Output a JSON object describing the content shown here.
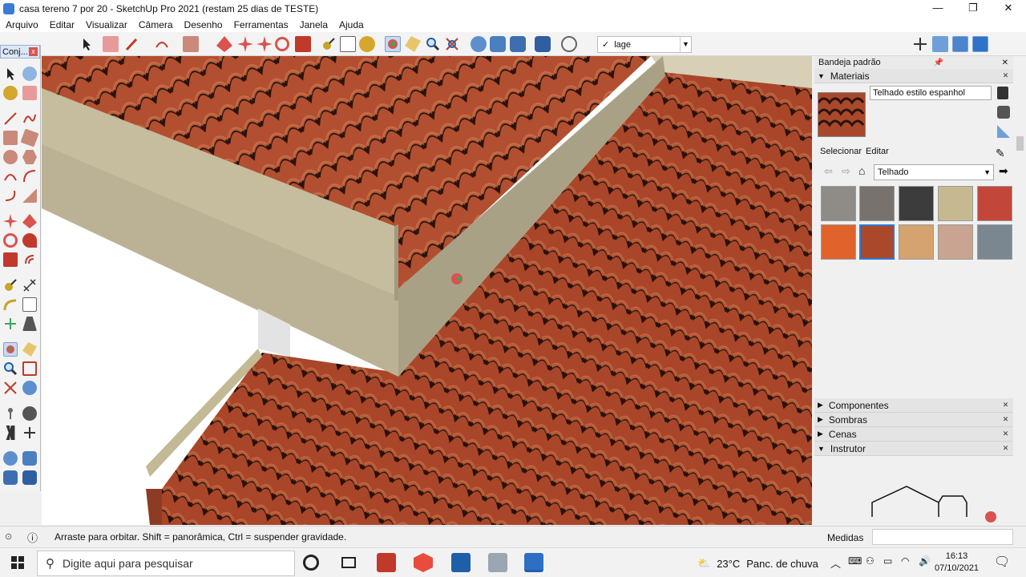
{
  "window": {
    "title": "casa tereno 7 por 20 - SketchUp Pro 2021 (restam 25 dias de TESTE)",
    "minimize": "—",
    "restore": "❐",
    "close": "✕"
  },
  "menu": [
    "Arquivo",
    "Editar",
    "Visualizar",
    "Câmera",
    "Desenho",
    "Ferramentas",
    "Janela",
    "Ajuda"
  ],
  "layer": {
    "check": "✓",
    "name": "lage"
  },
  "left_toolbar": {
    "title": "Conj...",
    "close": "x"
  },
  "tray": {
    "title": "Bandeja padrão",
    "materials": {
      "header": "Materiais",
      "current_name": "Telhado estilo espanhol",
      "tab_select": "Selecionar",
      "tab_edit": "Editar",
      "library": "Telhado",
      "swatches": [
        "#8f8c88",
        "#77726d",
        "#3c3c3c",
        "#c7b98f",
        "#c2463a",
        "#e0632c",
        "#a9482b",
        "#d4a36f",
        "#c8a491",
        "#7b8790"
      ]
    },
    "panels": [
      {
        "name": "Componentes",
        "collapsed": true
      },
      {
        "name": "Sombras",
        "collapsed": true
      },
      {
        "name": "Cenas",
        "collapsed": true
      },
      {
        "name": "Instrutor",
        "collapsed": false
      }
    ]
  },
  "status": {
    "message": "Arraste para orbitar. Shift = panorâmica, Ctrl = suspender gravidade.",
    "measure_label": "Medidas"
  },
  "taskbar": {
    "search_placeholder": "Digite aqui para pesquisar",
    "weather_temp": "23°C",
    "weather_desc": "Panc. de chuva",
    "time": "16:13",
    "date": "07/10/2021"
  },
  "colors": {
    "roof_tile": "#a9482b",
    "fascia": "#bdb493",
    "accent": "#3a7bd5"
  }
}
